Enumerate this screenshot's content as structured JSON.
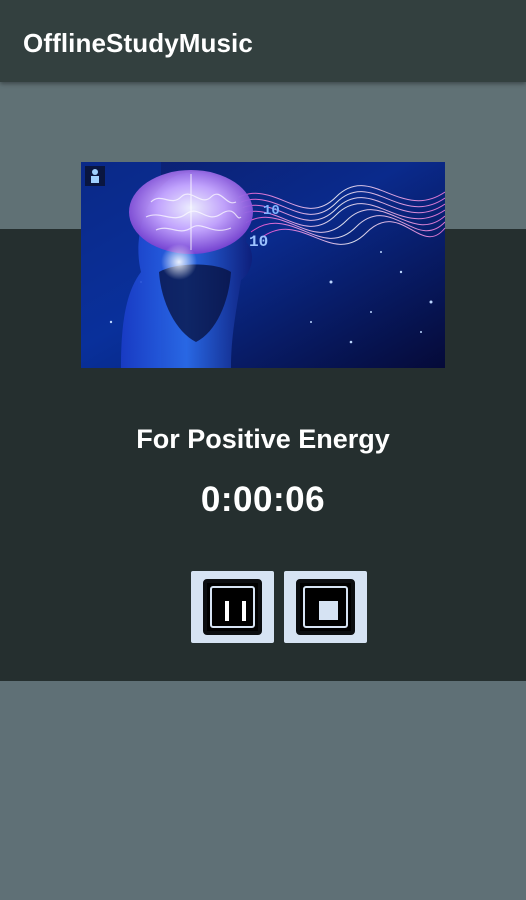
{
  "app": {
    "title": "OfflineStudyMusic"
  },
  "player": {
    "cover_icon": "brain-head-artwork",
    "track_title": "For Positive Energy",
    "elapsed_time": "0:00:06",
    "controls": {
      "pause_icon": "pause-icon",
      "stop_icon": "stop-icon"
    }
  },
  "colors": {
    "app_bar": "#33403f",
    "background": "#5f7076",
    "panel": "#252f2f",
    "button": "#d6e3f3",
    "text": "#ffffff"
  }
}
